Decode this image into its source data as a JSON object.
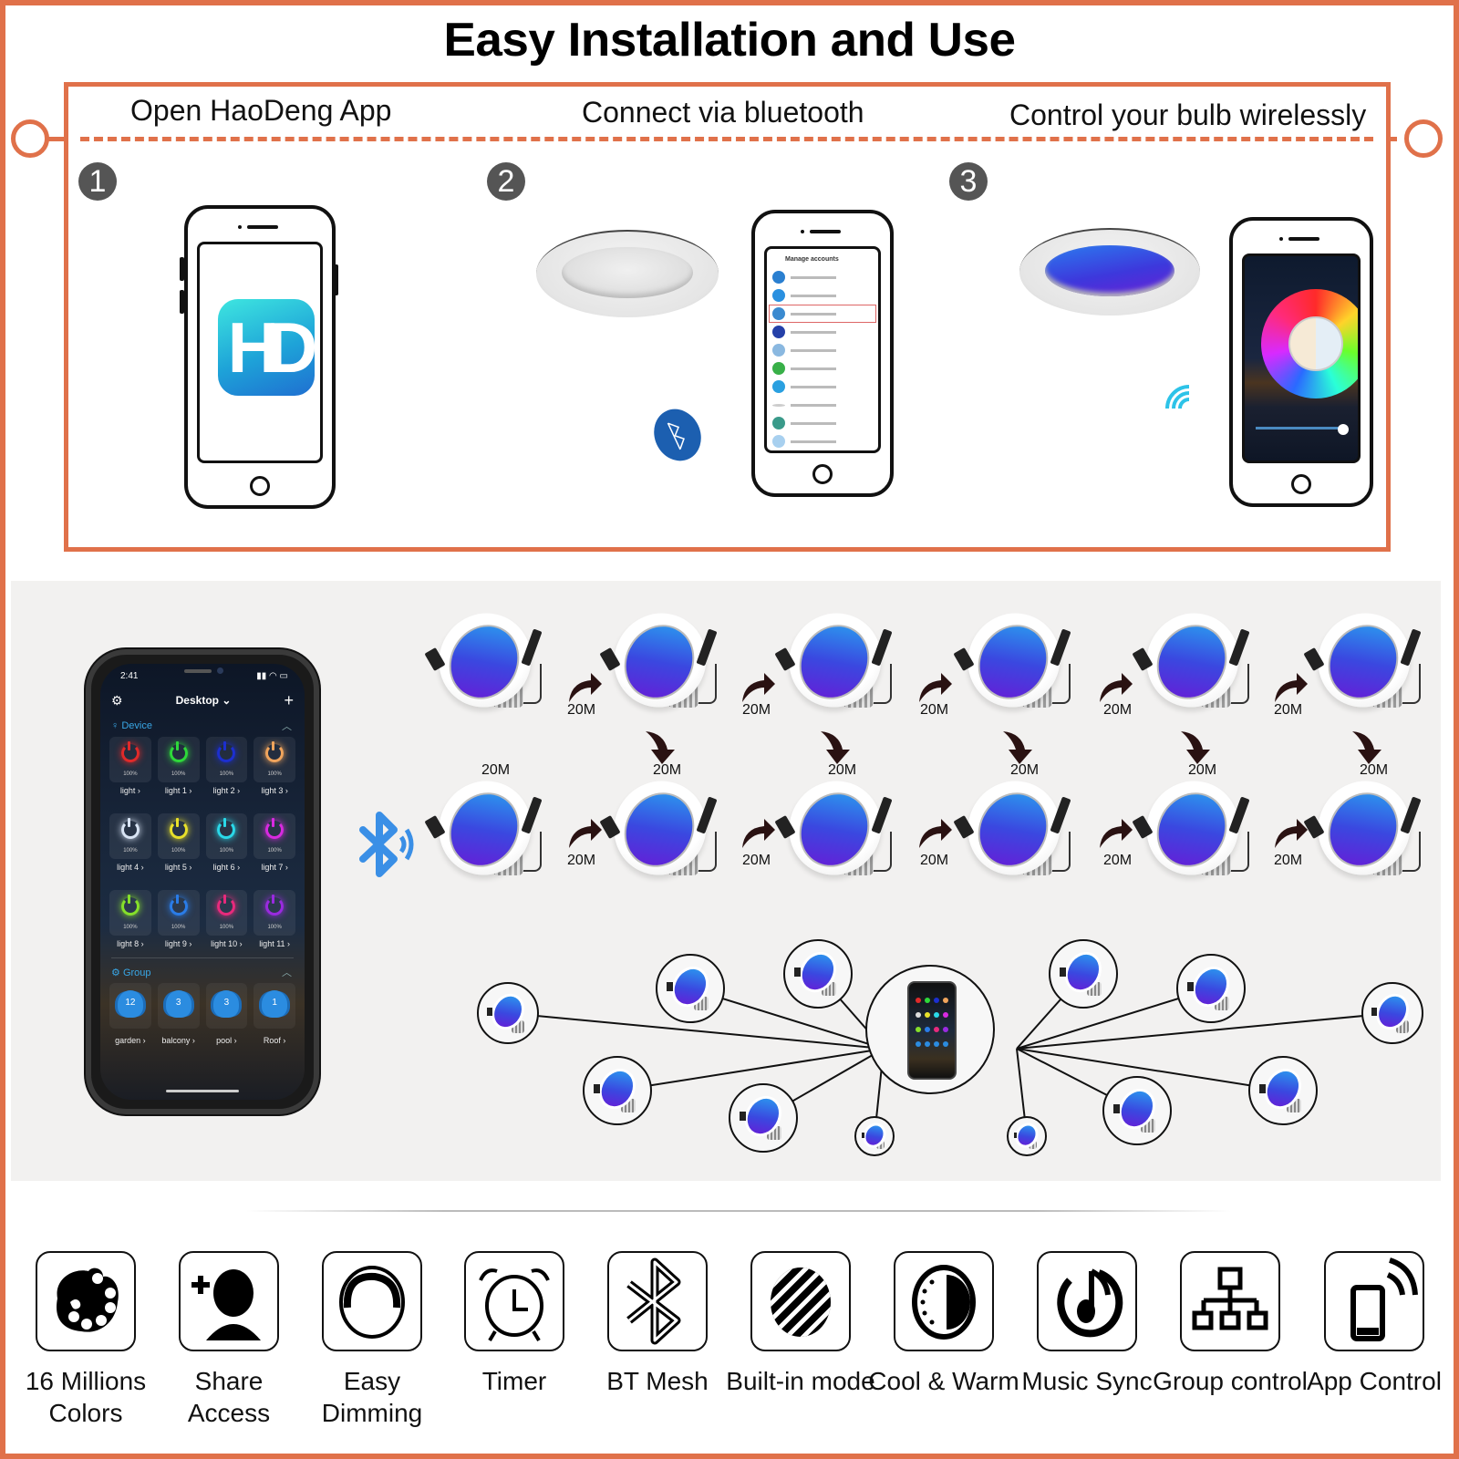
{
  "title": "Easy Installation and Use",
  "colors": {
    "accent": "#e0714a",
    "bluetooth": "#3a8fe6",
    "lens_blue": "#3a48e0",
    "lens_violet": "#6a1ad6",
    "app_link": "#39a7e6"
  },
  "steps": [
    {
      "number": "1",
      "label": "Open HaoDeng App",
      "app_icon_text": "HD"
    },
    {
      "number": "2",
      "label": "Connect via bluetooth",
      "phone_screen_title": "Manage accounts",
      "icon": "bluetooth-icon"
    },
    {
      "number": "3",
      "label": "Control your bulb wirelessly",
      "icon": "wireless-signal-icon"
    }
  ],
  "app": {
    "status_time": "2:41",
    "header_title": "Desktop",
    "header_caret": "⌄",
    "add_label": "+",
    "device_section": "Device",
    "group_section": "Group",
    "devices": [
      {
        "name": "light",
        "level": "100%",
        "color": "#e02a2a"
      },
      {
        "name": "light 1",
        "level": "100%",
        "color": "#2ed83a"
      },
      {
        "name": "light 2",
        "level": "100%",
        "color": "#1c2fcf"
      },
      {
        "name": "light 3",
        "level": "100%",
        "color": "#f0a45c"
      },
      {
        "name": "light 4",
        "level": "100%",
        "color": "#d8e4f4"
      },
      {
        "name": "light 5",
        "level": "100%",
        "color": "#e8e02a"
      },
      {
        "name": "light 6",
        "level": "100%",
        "color": "#2ad8e8"
      },
      {
        "name": "light 7",
        "level": "100%",
        "color": "#d82ae0"
      },
      {
        "name": "light 8",
        "level": "100%",
        "color": "#86e02a"
      },
      {
        "name": "light 9",
        "level": "100%",
        "color": "#2a7ce8"
      },
      {
        "name": "light 10",
        "level": "100%",
        "color": "#e82a7c"
      },
      {
        "name": "light 11",
        "level": "100%",
        "color": "#9a2ae0"
      }
    ],
    "groups": [
      {
        "name": "garden",
        "count": "12"
      },
      {
        "name": "balcony",
        "count": "3"
      },
      {
        "name": "pool",
        "count": "3"
      },
      {
        "name": "Roof",
        "count": "1"
      }
    ]
  },
  "mesh": {
    "distance_label": "20M",
    "top_row_distances": [
      "20M",
      "20M",
      "20M",
      "20M",
      "20M"
    ],
    "down_distances": [
      "20M",
      "20M",
      "20M",
      "20M",
      "20M",
      "20M"
    ],
    "bottom_row_distances": [
      "20M",
      "20M",
      "20M",
      "20M",
      "20M"
    ]
  },
  "features": [
    {
      "icon": "palette-icon",
      "label": "16 Millions Colors"
    },
    {
      "icon": "add-user-icon",
      "label": "Share Access"
    },
    {
      "icon": "dimmer-icon",
      "label": "Easy Dimming"
    },
    {
      "icon": "alarm-clock-icon",
      "label": "Timer"
    },
    {
      "icon": "bluetooth-icon",
      "label": "BT Mesh"
    },
    {
      "icon": "striped-circle-icon",
      "label": "Built-in mode"
    },
    {
      "icon": "half-circle-icon",
      "label": "Cool & Warm"
    },
    {
      "icon": "music-note-icon",
      "label": "Music Sync"
    },
    {
      "icon": "hierarchy-icon",
      "label": "Group control"
    },
    {
      "icon": "phone-signal-icon",
      "label": "App Control"
    }
  ]
}
